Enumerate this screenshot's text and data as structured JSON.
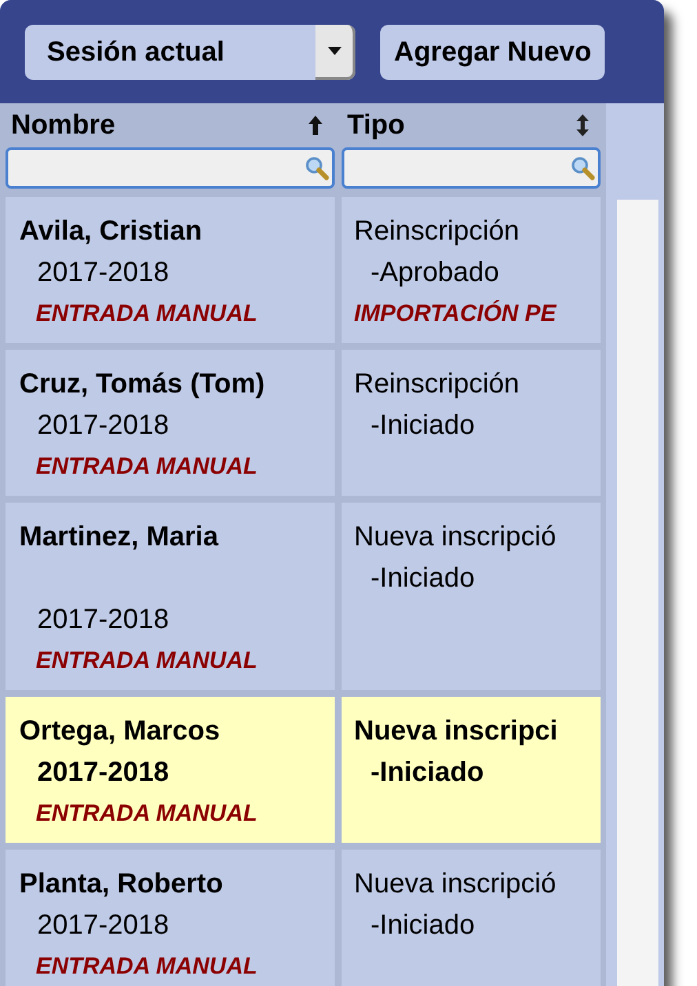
{
  "toolbar": {
    "session_select": {
      "value": "Sesión actual"
    },
    "add_button": "Agregar Nuevo"
  },
  "table": {
    "columns": [
      {
        "label": "Nombre",
        "sorted": true
      },
      {
        "label": "Tipo",
        "sorted": false
      }
    ],
    "rows": [
      {
        "name": "Avila, Cristian",
        "year": "2017-2018",
        "source": "ENTRADA MANUAL",
        "type": "Reinscripción",
        "status": "-Aprobado",
        "notice": "IMPORTACIÓN PE",
        "spacer": false,
        "selected": false
      },
      {
        "name": "Cruz, Tomás (Tom)",
        "year": "2017-2018",
        "source": "ENTRADA MANUAL",
        "type": "Reinscripción",
        "status": "-Iniciado",
        "spacer": false,
        "selected": false
      },
      {
        "name": "Martinez, Maria",
        "year": "2017-2018",
        "source": "ENTRADA MANUAL",
        "type": "Nueva inscripció",
        "status": "-Iniciado",
        "spacer": true,
        "selected": false
      },
      {
        "name": "Ortega, Marcos",
        "year": "2017-2018",
        "source": "ENTRADA MANUAL",
        "type": "Nueva inscripci",
        "status": "-Iniciado",
        "spacer": false,
        "selected": true
      },
      {
        "name": "Planta, Roberto",
        "year": "2017-2018",
        "source": "ENTRADA MANUAL",
        "type": "Nueva inscripció",
        "status": "-Iniciado",
        "spacer": false,
        "selected": false
      }
    ]
  }
}
